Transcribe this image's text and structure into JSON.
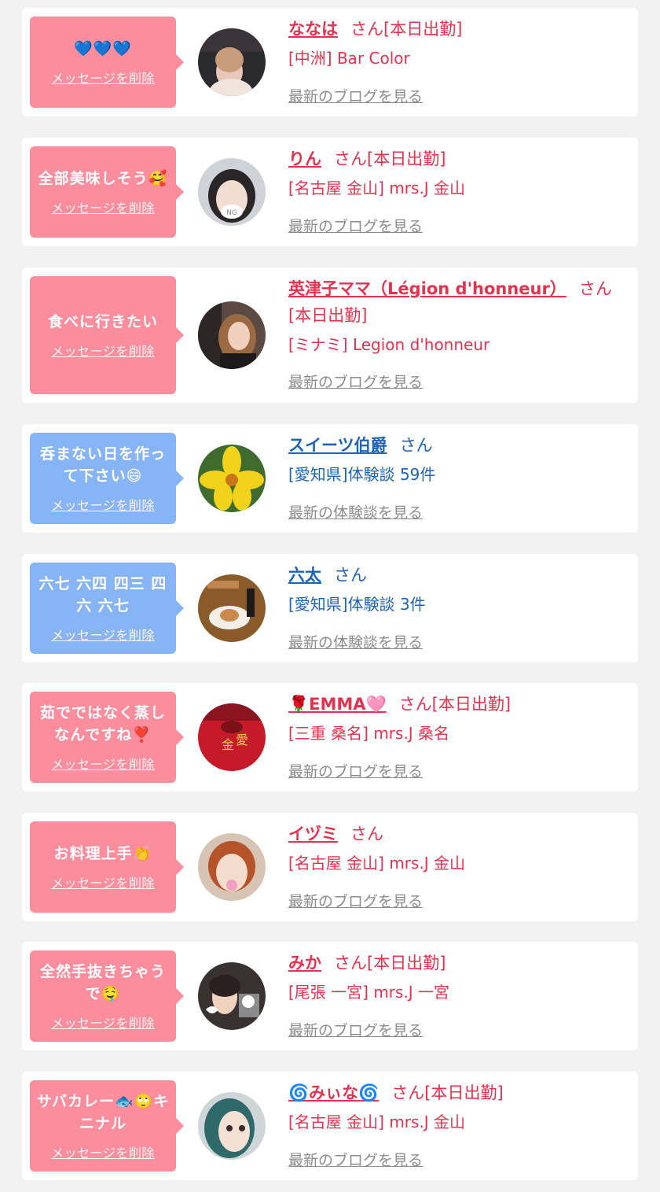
{
  "delete_label": "メッセージを削除",
  "colors": {
    "pink_bubble": "#fb8d9c",
    "blue_bubble": "#86b4f5",
    "pink_text": "#e3334f",
    "blue_text": "#1f63b4",
    "link_gray": "#8c8c8c"
  },
  "items": [
    {
      "message": "💙💙💙",
      "name": "ななは",
      "suffix": "さん[本日出勤]",
      "shop": "[中洲] Bar Color",
      "more": "最新のブログを見る",
      "type": "cast",
      "avatar": "woman-at-bar"
    },
    {
      "message": "全部美味しそう🥰",
      "name": "りん",
      "suffix": "さん[本日出勤]",
      "shop": "[名古屋 金山] mrs.J 金山",
      "more": "最新のブログを見る",
      "type": "cast",
      "avatar": "woman-with-ng-mask"
    },
    {
      "message": "食べに行きたい",
      "name": "英津子ママ（Légion d'honneur）",
      "suffix": "さん[本日出勤]",
      "shop": "[ミナミ] Legion d'honneur",
      "more": "最新のブログを見る",
      "type": "cast",
      "avatar": "woman-long-hair"
    },
    {
      "message": "呑まない日を作って下さい😄",
      "name": "スイーツ伯爵",
      "suffix": "さん",
      "shop": "[愛知県]体験談 59件",
      "more": "最新の体験談を見る",
      "type": "user",
      "avatar": "yellow-flower"
    },
    {
      "message": "六七 六四 四三 四六 六七",
      "name": "六太",
      "suffix": "さん",
      "shop": "[愛知県]体験談 3件",
      "more": "最新の体験談を見る",
      "type": "user",
      "avatar": "food-plate"
    },
    {
      "message": "茹でではなく蒸しなんですね❣️",
      "name": "🌹EMMA🩷",
      "suffix": "さん[本日出勤]",
      "shop": "[三重 桑名] mrs.J 桑名",
      "more": "最新のブログを見る",
      "type": "cast",
      "avatar": "red-sweater"
    },
    {
      "message": "お料理上手👏",
      "name": "イヅミ",
      "suffix": "さん",
      "shop": "[名古屋 金山] mrs.J 金山",
      "more": "最新のブログを見る",
      "type": "cast",
      "avatar": "woman-red-hair"
    },
    {
      "message": "全然手抜きちゃうで🤤",
      "name": "みか",
      "suffix": "さん[本日出勤]",
      "shop": "[尾張 一宮] mrs.J 一宮",
      "more": "最新のブログを見る",
      "type": "cast",
      "avatar": "woman-with-cat"
    },
    {
      "message": "サバカレー🐟🙄キニナル",
      "name": "🌀みぃな🌀",
      "suffix": "さん[本日出勤]",
      "shop": "[名古屋 金山] mrs.J 金山",
      "more": "最新のブログを見る",
      "type": "cast",
      "avatar": "woman-teal-hair"
    }
  ]
}
